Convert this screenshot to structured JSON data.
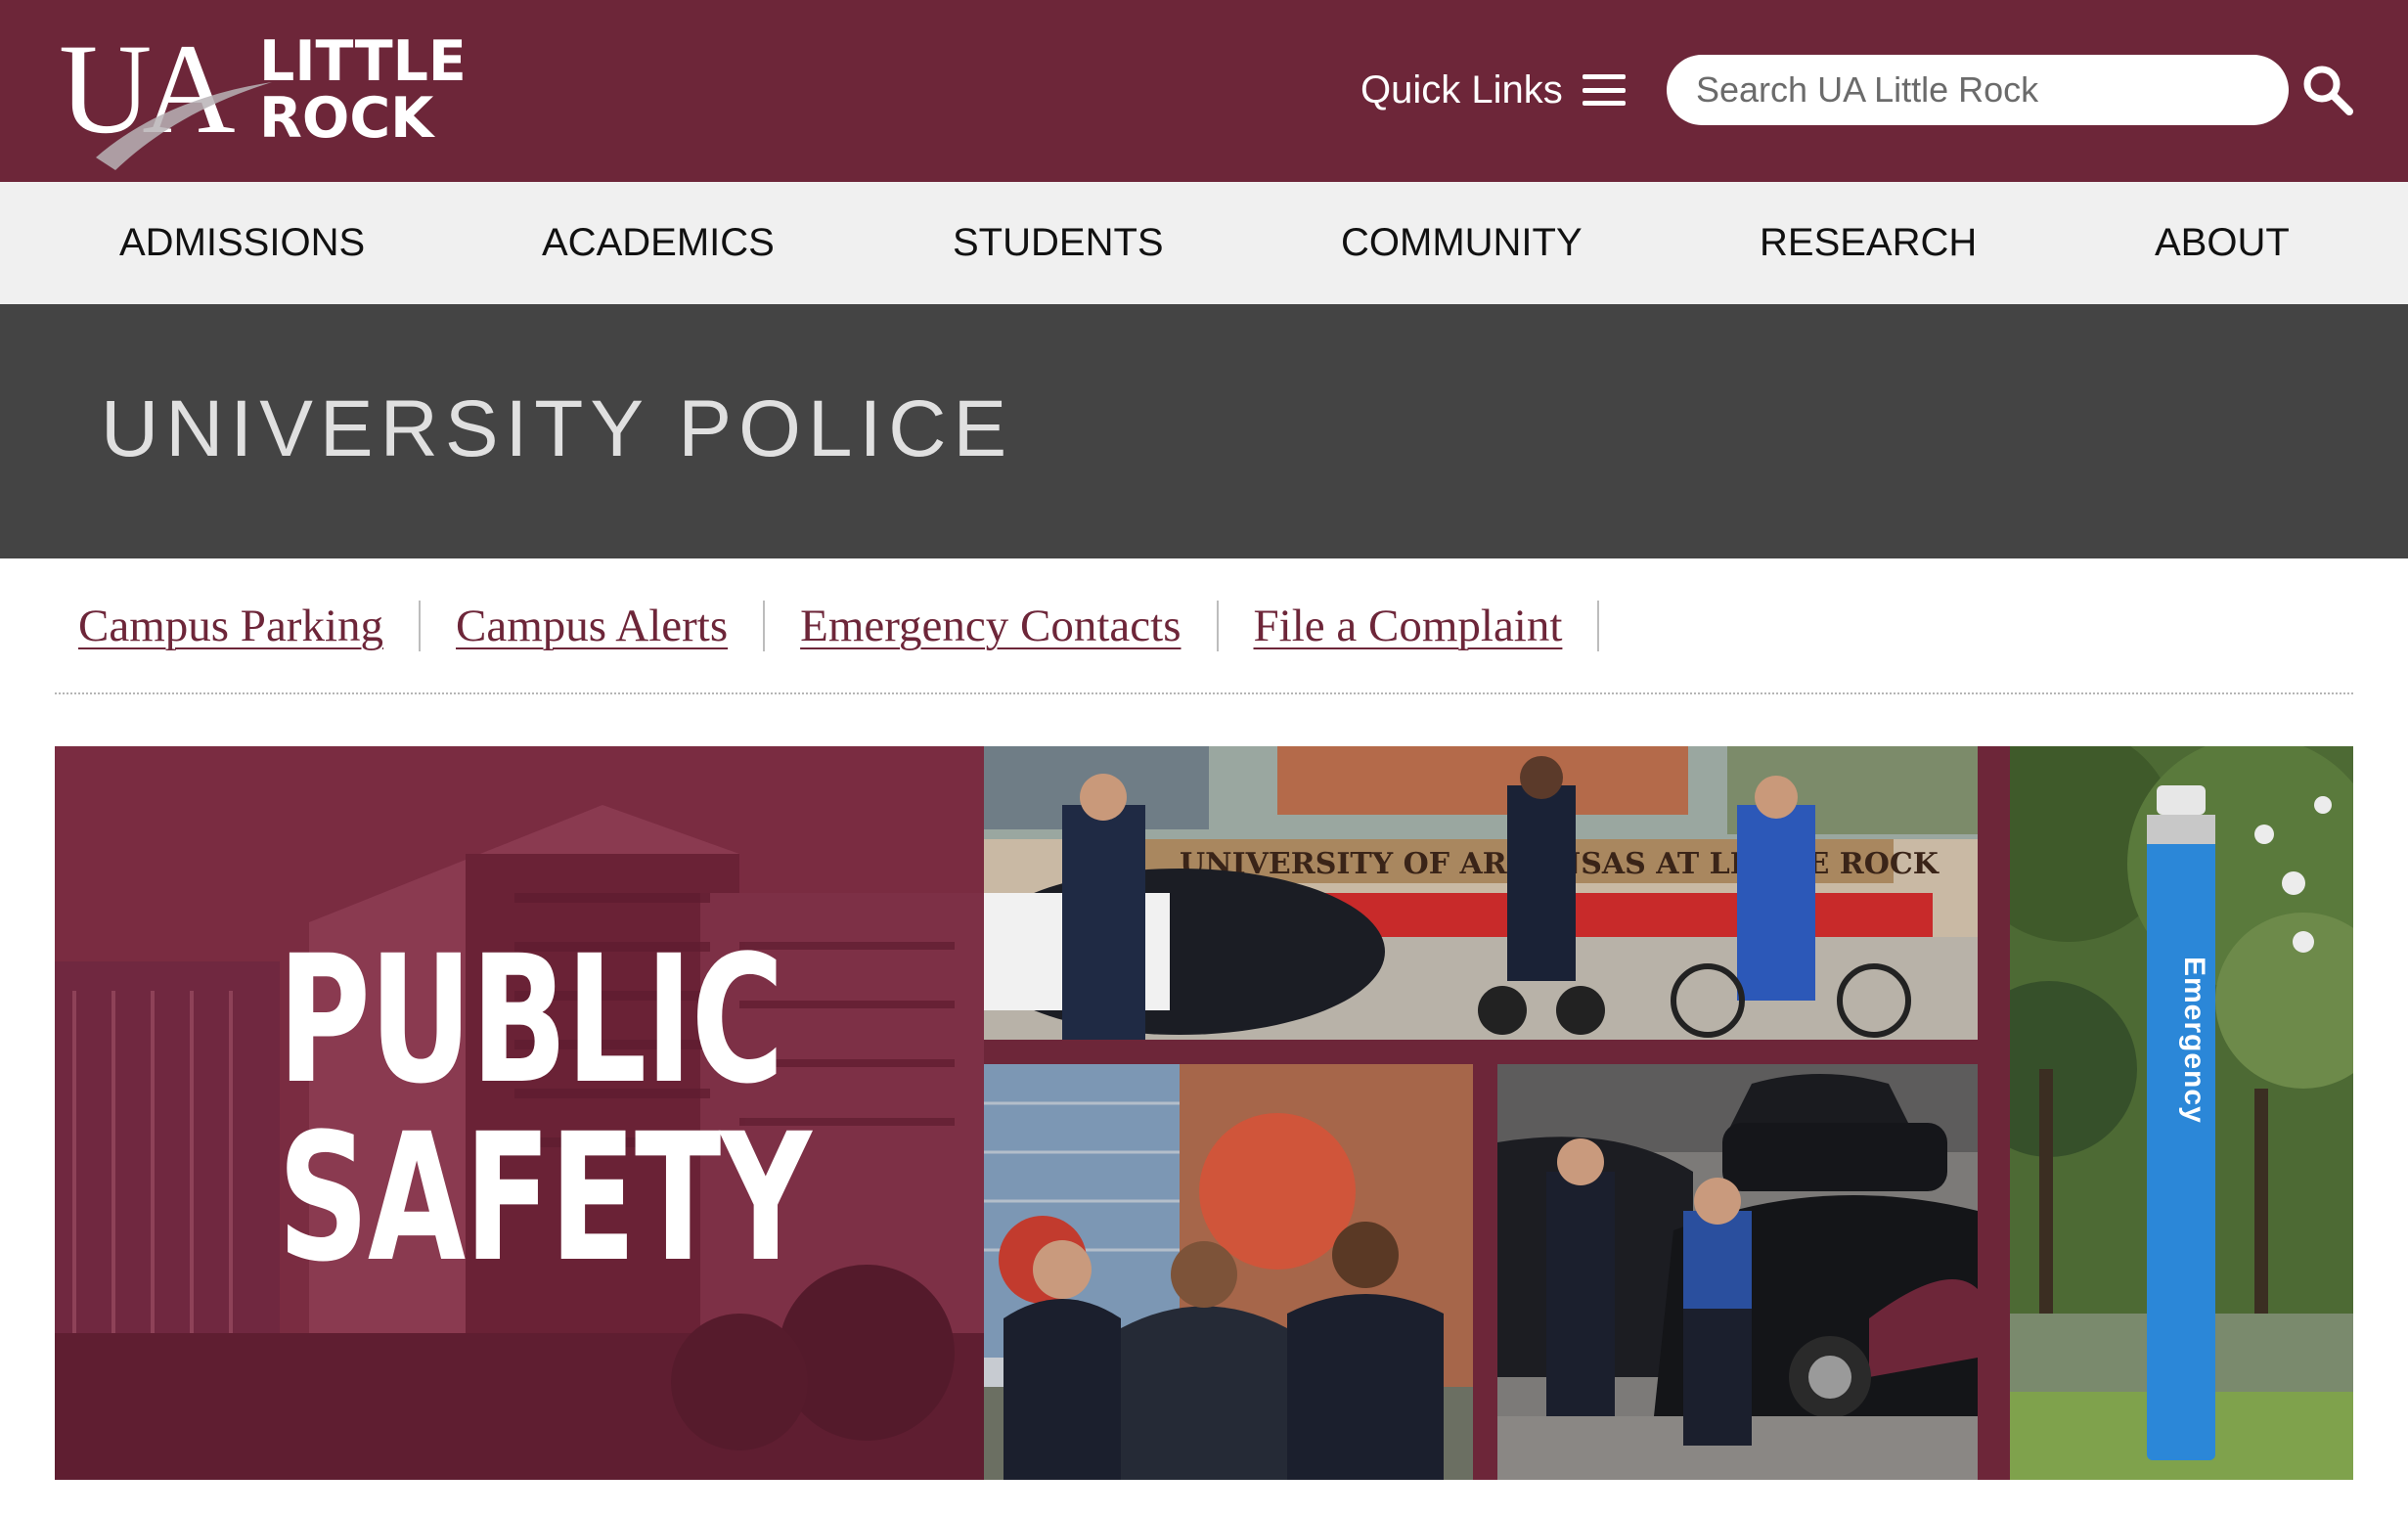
{
  "header": {
    "logo": {
      "ua": "UA",
      "line1": "LITTLE",
      "line2": "ROCK"
    },
    "quick_links_label": "Quick Links",
    "search": {
      "placeholder": "Search UA Little Rock",
      "value": ""
    },
    "icons": {
      "menu": "hamburger-icon",
      "search": "search-icon"
    },
    "brand_color": "#6d2639"
  },
  "nav": {
    "items": [
      {
        "label": "ADMISSIONS"
      },
      {
        "label": "ACADEMICS"
      },
      {
        "label": "STUDENTS"
      },
      {
        "label": "COMMUNITY"
      },
      {
        "label": "RESEARCH"
      },
      {
        "label": "ABOUT"
      }
    ]
  },
  "page": {
    "title": "UNIVERSITY POLICE",
    "banner_color": "#444444"
  },
  "sublinks": [
    {
      "label": "Campus Parking"
    },
    {
      "label": "Campus Alerts"
    },
    {
      "label": "Emergency Contacts"
    },
    {
      "label": "File a Complaint"
    }
  ],
  "hero": {
    "title_line1": "PUBLIC",
    "title_line2": "SAFETY",
    "photo_sign_text": "UNIVERSITY OF ARKANSAS AT LITTLE ROCK",
    "emergency_label": "Emergency"
  }
}
